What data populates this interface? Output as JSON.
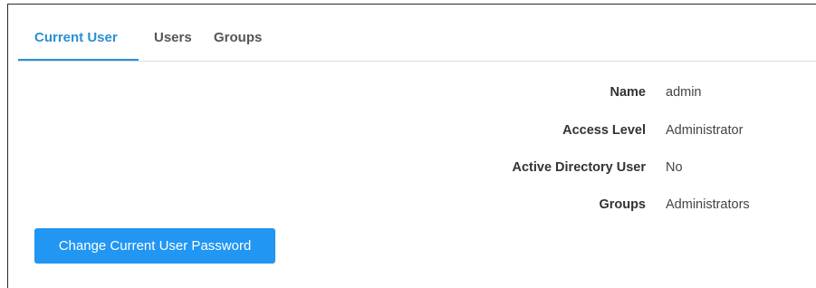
{
  "tabs": [
    {
      "label": "Current User",
      "active": true
    },
    {
      "label": "Users",
      "active": false
    },
    {
      "label": "Groups",
      "active": false
    }
  ],
  "user_info": {
    "name_label": "Name",
    "name_value": "admin",
    "access_label": "Access Level",
    "access_value": "Administrator",
    "ad_label": "Active Directory User",
    "ad_value": "No",
    "groups_label": "Groups",
    "groups_value": "Administrators"
  },
  "actions": {
    "change_password_label": "Change Current User Password"
  },
  "colors": {
    "accent": "#2a8fd6",
    "button_bg": "#2196f3",
    "tab_border": "#dcdcdc",
    "text": "#333333"
  }
}
